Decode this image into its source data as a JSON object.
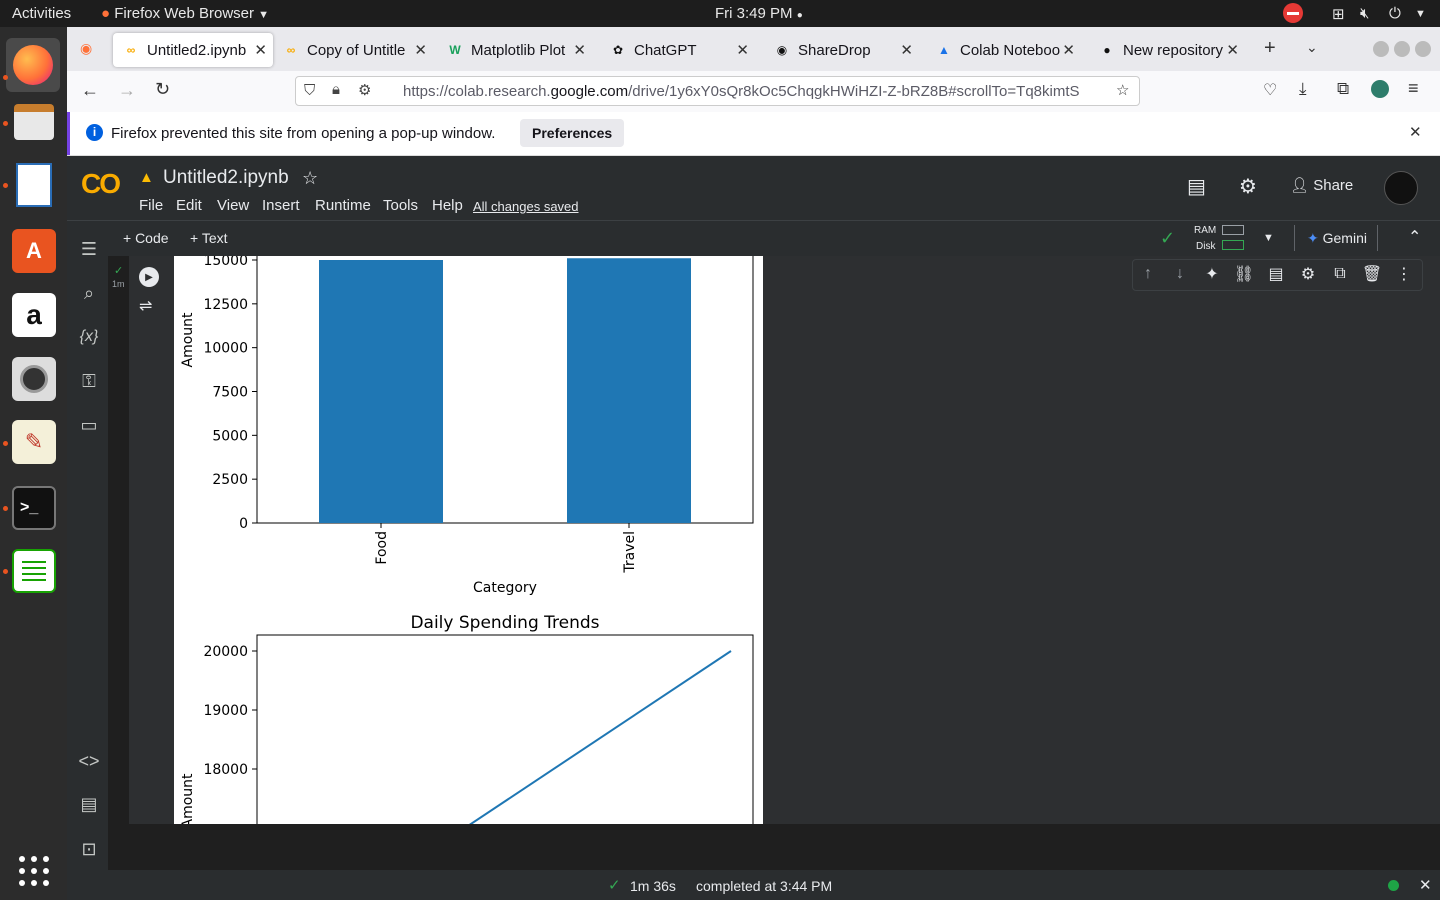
{
  "gnome": {
    "activities": "Activities",
    "app_name": "Firefox Web Browser",
    "clock": "Fri  3:49 PM"
  },
  "firefox": {
    "tabs": [
      {
        "title": "Untitled2.ipynb",
        "active": true,
        "icon": "colab-icon"
      },
      {
        "title": "Copy of Untitle",
        "active": false,
        "icon": "colab-icon"
      },
      {
        "title": "Matplotlib Plot",
        "active": false,
        "icon": "w-icon"
      },
      {
        "title": "ChatGPT",
        "active": false,
        "icon": "chatgpt-icon"
      },
      {
        "title": "ShareDrop",
        "active": false,
        "icon": "sharedrop-icon"
      },
      {
        "title": "Colab Noteboo",
        "active": false,
        "icon": "drive-icon"
      },
      {
        "title": "New repository",
        "active": false,
        "icon": "github-icon"
      }
    ],
    "url_prefix": "https://colab.research.",
    "url_domain": "google.com",
    "url_rest": "/drive/1y6xY0sQr8kOc5ChqgkHWiHZI-Z-bRZ8B#scrollTo=Tq8kimtS",
    "popup_message": "Firefox prevented this site from opening a pop-up window.",
    "popup_button": "Preferences"
  },
  "colab": {
    "logo": "CO",
    "notebook_title": "Untitled2.ipynb",
    "menu": [
      "File",
      "Edit",
      "View",
      "Insert",
      "Runtime",
      "Tools",
      "Help"
    ],
    "save_status": "All changes saved",
    "share_label": "Share",
    "add_code": "+ Code",
    "add_text": "+ Text",
    "ram_label": "RAM",
    "disk_label": "Disk",
    "gemini_label": "Gemini",
    "exec_time_short": "1m",
    "status_duration": "1m 36s",
    "status_completed": "completed at 3:44 PM"
  },
  "chart_data": [
    {
      "type": "bar",
      "title": "",
      "xlabel": "Category",
      "ylabel": "Amount",
      "categories": [
        "Food",
        "Travel"
      ],
      "values": [
        15000,
        15100
      ],
      "ylim": [
        0,
        15000
      ],
      "yticks": [
        0,
        2500,
        5000,
        7500,
        10000,
        12500,
        15000
      ],
      "color": "#1f77b4",
      "grid": false
    },
    {
      "type": "line",
      "title": "Daily Spending Trends",
      "xlabel": "",
      "ylabel": "Amount",
      "y_visible_range": [
        17100,
        20250
      ],
      "yticks": [
        18000,
        19000,
        20000
      ],
      "series_end_value": 20000,
      "color": "#1f77b4",
      "grid": false
    }
  ]
}
